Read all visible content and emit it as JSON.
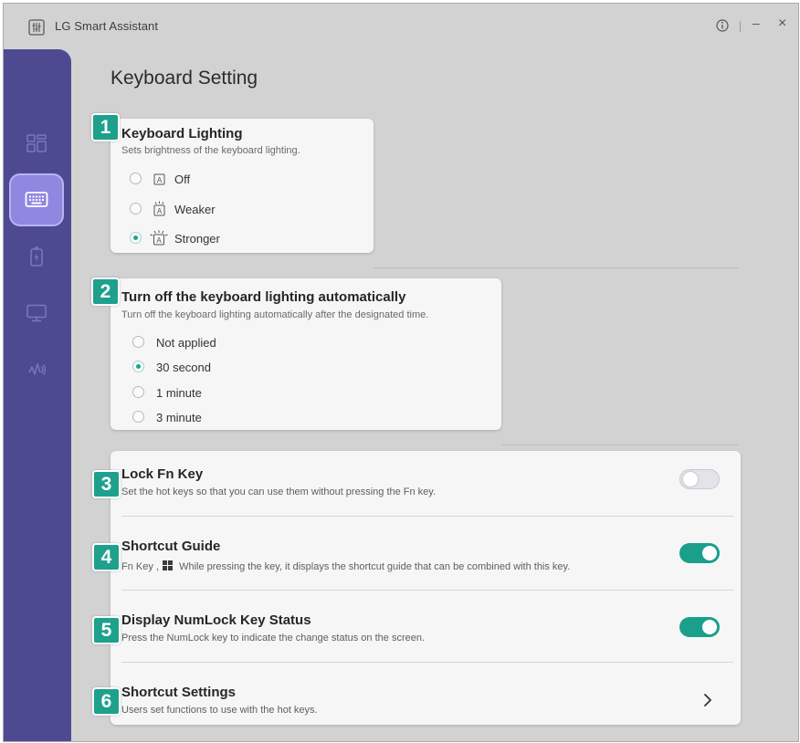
{
  "app": {
    "title": "LG Smart Assistant"
  },
  "window_controls": {
    "info_icon": "info-circle-icon",
    "minimize": "–",
    "close": "×"
  },
  "sidebar": {
    "items": [
      {
        "icon": "dashboard-icon",
        "active": false
      },
      {
        "icon": "keyboard-icon",
        "active": true
      },
      {
        "icon": "battery-icon",
        "active": false
      },
      {
        "icon": "monitor-icon",
        "active": false
      },
      {
        "icon": "audio-icon",
        "active": false
      }
    ]
  },
  "page": {
    "title": "Keyboard Setting"
  },
  "keyboard_lighting": {
    "badge": "1",
    "title": "Keyboard Lighting",
    "subtitle": "Sets brightness of the keyboard lighting.",
    "options": [
      {
        "label": "Off",
        "selected": false,
        "icon": "key-off-icon"
      },
      {
        "label": "Weaker",
        "selected": false,
        "icon": "key-weak-light-icon"
      },
      {
        "label": "Stronger",
        "selected": true,
        "icon": "key-strong-light-icon"
      }
    ]
  },
  "auto_off": {
    "badge": "2",
    "title": "Turn off the keyboard lighting automatically",
    "subtitle": "Turn off the keyboard lighting automatically after the designated time.",
    "options": [
      {
        "label": "Not applied",
        "selected": false
      },
      {
        "label": "30 second",
        "selected": true
      },
      {
        "label": "1 minute",
        "selected": false
      },
      {
        "label": "3 minute",
        "selected": false
      }
    ]
  },
  "settings": [
    {
      "badge": "3",
      "title": "Lock Fn Key",
      "subtitle": "Set the hot keys so that you can use them without pressing the Fn key.",
      "control": "toggle",
      "on": false
    },
    {
      "badge": "4",
      "title": "Shortcut Guide",
      "subtitle_prefix": "Fn Key ,",
      "subtitle_icon": "windows-logo-icon",
      "subtitle": "While pressing the key, it displays the shortcut guide that can be combined with this key.",
      "control": "toggle",
      "on": true
    },
    {
      "badge": "5",
      "title": "Display NumLock Key Status",
      "subtitle": "Press the NumLock key to indicate the change status on the screen.",
      "control": "toggle",
      "on": true
    },
    {
      "badge": "6",
      "title": "Shortcut Settings",
      "subtitle": "Users set functions to use with the hot keys.",
      "control": "chevron"
    }
  ],
  "colors": {
    "accent": "#1a9f8c",
    "sidebar": "#4e4a92",
    "sidebar_active": "#8f87e0",
    "background": "#d2d2d2",
    "card": "#f6f6f6"
  }
}
